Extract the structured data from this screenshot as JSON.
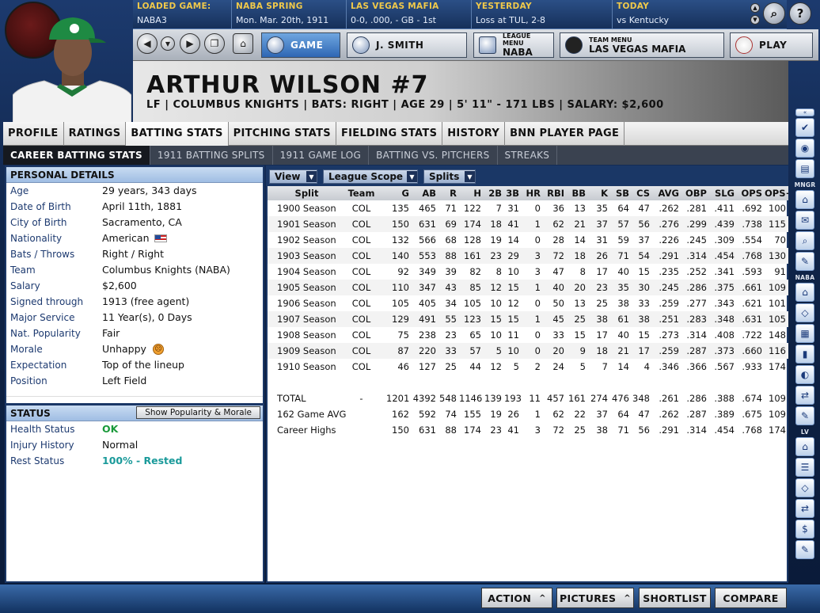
{
  "topbar": [
    {
      "label": "LOADED GAME:",
      "value": "NABA3"
    },
    {
      "label": "NABA SPRING",
      "value": "Mon. Mar. 20th, 1911"
    },
    {
      "label": "LAS VEGAS  MAFIA",
      "value": "0-0, .000, - GB - 1st"
    },
    {
      "label": "YESTERDAY",
      "value": "Loss at TUL, 2-8"
    },
    {
      "label": "TODAY",
      "value": "vs Kentucky"
    }
  ],
  "nav": {
    "game": "GAME",
    "manager": "J. SMITH",
    "league_menu_label": "LEAGUE MENU",
    "league_menu_value": "NABA",
    "team_menu_label": "TEAM MENU",
    "team_menu_value": "LAS VEGAS  MAFIA",
    "play": "PLAY"
  },
  "player": {
    "name": "ARTHUR WILSON  #7",
    "subtitle": "LF | COLUMBUS  KNIGHTS | BATS: RIGHT | AGE 29 | 5' 11\" - 171 LBS | SALARY: $2,600"
  },
  "tabs": [
    "PROFILE",
    "RATINGS",
    "BATTING STATS",
    "PITCHING STATS",
    "FIELDING STATS",
    "HISTORY",
    "BNN PLAYER PAGE"
  ],
  "subtabs": [
    "CAREER BATTING STATS",
    "1911 BATTING SPLITS",
    "1911 GAME LOG",
    "BATTING VS. PITCHERS",
    "STREAKS"
  ],
  "personal": {
    "title": "PERSONAL DETAILS",
    "rows": [
      {
        "k": "Age",
        "v": "29 years, 343 days"
      },
      {
        "k": "Date of Birth",
        "v": "April 11th, 1881"
      },
      {
        "k": "City of Birth",
        "v": "Sacramento, CA"
      },
      {
        "k": "Nationality",
        "v": "American"
      },
      {
        "k": "Bats / Throws",
        "v": "Right / Right"
      },
      {
        "k": "Team",
        "v": "Columbus  Knights (NABA)"
      },
      {
        "k": "Salary",
        "v": "$2,600"
      },
      {
        "k": "Signed through",
        "v": "1913 (free agent)"
      },
      {
        "k": "Major Service",
        "v": "11 Year(s), 0 Days"
      },
      {
        "k": "Nat. Popularity",
        "v": "Fair"
      },
      {
        "k": "Morale",
        "v": "Unhappy"
      },
      {
        "k": "Expectation",
        "v": "Top of the lineup"
      },
      {
        "k": "Position",
        "v": "Left Field"
      }
    ]
  },
  "status": {
    "title": "STATUS",
    "button": "Show Popularity & Morale",
    "health_label": "Health Status",
    "health_value": "OK",
    "injury_label": "Injury History",
    "injury_value": "Normal",
    "rest_label": "Rest Status",
    "rest_value": "100% - Rested",
    "status_color": "#1a9a3a"
  },
  "toolbar": [
    "View",
    "League Scope",
    "Splits"
  ],
  "columns": [
    "Split",
    "Team",
    "G",
    "AB",
    "R",
    "H",
    "2B",
    "3B",
    "HR",
    "RBI",
    "BB",
    "K",
    "SB",
    "CS",
    "AVG",
    "OBP",
    "SLG",
    "OPS",
    "OPS+"
  ],
  "seasons": [
    [
      "1900 Season",
      "COL",
      "135",
      "465",
      "71",
      "122",
      "7",
      "31",
      "0",
      "36",
      "13",
      "35",
      "64",
      "47",
      ".262",
      ".281",
      ".411",
      ".692",
      "100"
    ],
    [
      "1901 Season",
      "COL",
      "150",
      "631",
      "69",
      "174",
      "18",
      "41",
      "1",
      "62",
      "21",
      "37",
      "57",
      "56",
      ".276",
      ".299",
      ".439",
      ".738",
      "115"
    ],
    [
      "1902 Season",
      "COL",
      "132",
      "566",
      "68",
      "128",
      "19",
      "14",
      "0",
      "28",
      "14",
      "31",
      "59",
      "37",
      ".226",
      ".245",
      ".309",
      ".554",
      "70"
    ],
    [
      "1903 Season",
      "COL",
      "140",
      "553",
      "88",
      "161",
      "23",
      "29",
      "3",
      "72",
      "18",
      "26",
      "71",
      "54",
      ".291",
      ".314",
      ".454",
      ".768",
      "130"
    ],
    [
      "1904 Season",
      "COL",
      "92",
      "349",
      "39",
      "82",
      "8",
      "10",
      "3",
      "47",
      "8",
      "17",
      "40",
      "15",
      ".235",
      ".252",
      ".341",
      ".593",
      "91"
    ],
    [
      "1905 Season",
      "COL",
      "110",
      "347",
      "43",
      "85",
      "12",
      "15",
      "1",
      "40",
      "20",
      "23",
      "35",
      "30",
      ".245",
      ".286",
      ".375",
      ".661",
      "109"
    ],
    [
      "1906 Season",
      "COL",
      "105",
      "405",
      "34",
      "105",
      "10",
      "12",
      "0",
      "50",
      "13",
      "25",
      "38",
      "33",
      ".259",
      ".277",
      ".343",
      ".621",
      "101"
    ],
    [
      "1907 Season",
      "COL",
      "129",
      "491",
      "55",
      "123",
      "15",
      "15",
      "1",
      "45",
      "25",
      "38",
      "61",
      "38",
      ".251",
      ".283",
      ".348",
      ".631",
      "105"
    ],
    [
      "1908 Season",
      "COL",
      "75",
      "238",
      "23",
      "65",
      "10",
      "11",
      "0",
      "33",
      "15",
      "17",
      "40",
      "15",
      ".273",
      ".314",
      ".408",
      ".722",
      "148"
    ],
    [
      "1909 Season",
      "COL",
      "87",
      "220",
      "33",
      "57",
      "5",
      "10",
      "0",
      "20",
      "9",
      "18",
      "21",
      "17",
      ".259",
      ".287",
      ".373",
      ".660",
      "116"
    ],
    [
      "1910 Season",
      "COL",
      "46",
      "127",
      "25",
      "44",
      "12",
      "5",
      "2",
      "24",
      "5",
      "7",
      "14",
      "4",
      ".346",
      ".366",
      ".567",
      ".933",
      "174"
    ]
  ],
  "totals": [
    [
      "TOTAL",
      "-",
      "1201",
      "4392",
      "548",
      "1146",
      "139",
      "193",
      "11",
      "457",
      "161",
      "274",
      "476",
      "348",
      ".261",
      ".286",
      ".388",
      ".674",
      "109"
    ],
    [
      "162 Game AVG",
      "",
      "162",
      "592",
      "74",
      "155",
      "19",
      "26",
      "1",
      "62",
      "22",
      "37",
      "64",
      "47",
      ".262",
      ".287",
      ".389",
      ".675",
      "109"
    ],
    [
      "Career Highs",
      "",
      "150",
      "631",
      "88",
      "174",
      "23",
      "41",
      "3",
      "72",
      "25",
      "38",
      "71",
      "56",
      ".291",
      ".314",
      ".454",
      ".768",
      "174"
    ]
  ],
  "sidebar_labels": {
    "mngr": "MNGR",
    "league": "NABA",
    "team": "LV"
  },
  "bottom": {
    "action": "ACTION",
    "pictures": "PICTURES",
    "shortlist": "SHORTLIST",
    "compare": "COMPARE"
  }
}
